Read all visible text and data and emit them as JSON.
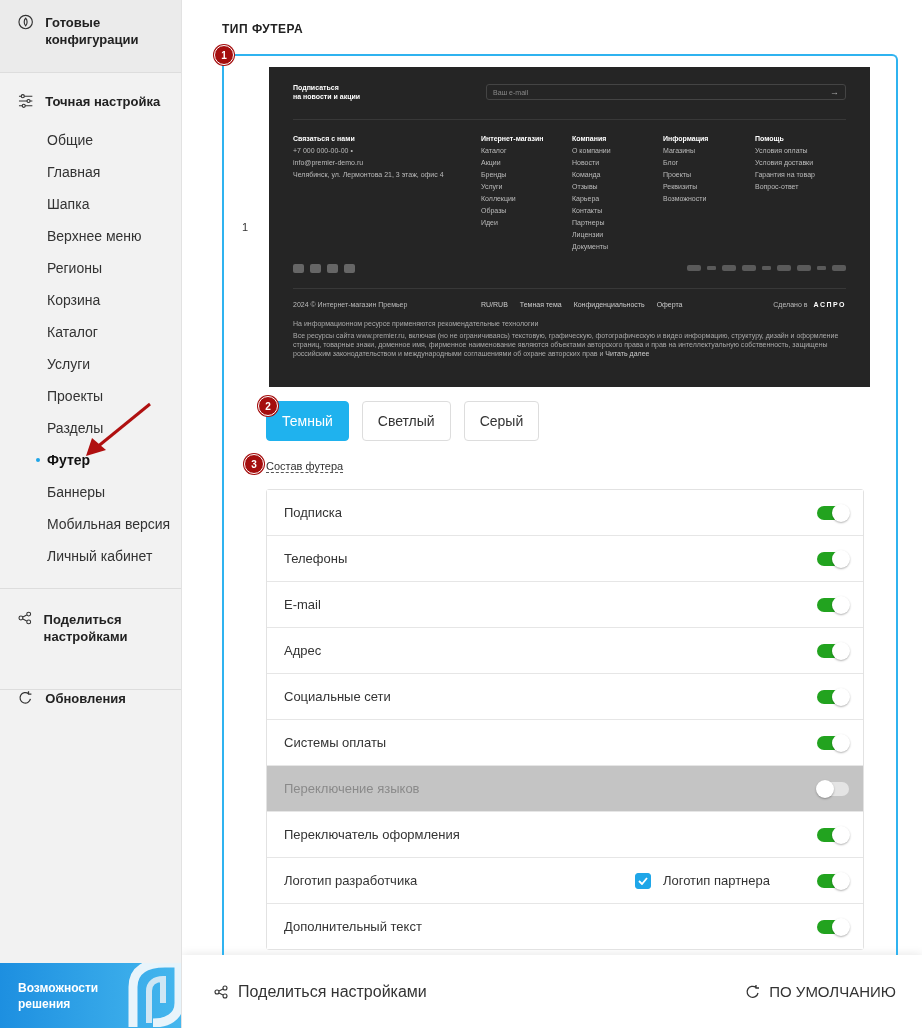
{
  "sidebar": {
    "presets": {
      "label": "Готовые конфигурации"
    },
    "tuning": {
      "label": "Точная настройка",
      "items": [
        {
          "label": "Общие",
          "selected": false
        },
        {
          "label": "Главная",
          "selected": false
        },
        {
          "label": "Шапка",
          "selected": false
        },
        {
          "label": "Верхнее меню",
          "selected": false
        },
        {
          "label": "Регионы",
          "selected": false
        },
        {
          "label": "Корзина",
          "selected": false
        },
        {
          "label": "Каталог",
          "selected": false
        },
        {
          "label": "Услуги",
          "selected": false
        },
        {
          "label": "Проекты",
          "selected": false
        },
        {
          "label": "Разделы",
          "selected": false
        },
        {
          "label": "Футер",
          "selected": true
        },
        {
          "label": "Баннеры",
          "selected": false
        },
        {
          "label": "Мобильная версия",
          "selected": false
        },
        {
          "label": "Личный кабинет",
          "selected": false
        }
      ]
    },
    "share": {
      "label": "Поделиться настройками"
    },
    "updates": {
      "label": "Обновления"
    },
    "promo": {
      "label": "Возможности решения"
    }
  },
  "main": {
    "section_title": "ТИП ФУТЕРА",
    "variant": {
      "badge": "1",
      "label": "1",
      "preview": {
        "subscribe": {
          "title": "Подписаться",
          "subtitle": "на новости и акции",
          "placeholder": "Ваш e-mail",
          "submit": "→"
        },
        "contacts": {
          "title": "Связаться с нами",
          "lines": [
            "+7 000 000-00-00 •",
            "info@premier-demo.ru",
            "Челябинск, ул. Лермонтова 21, 3 этаж, офис 4"
          ]
        },
        "columns": [
          {
            "title": "Интернет-магазин",
            "links": [
              "Каталог",
              "Акции",
              "Бренды",
              "Услуги",
              "Коллекции",
              "Образы",
              "Идеи"
            ]
          },
          {
            "title": "Компания",
            "links": [
              "О компании",
              "Новости",
              "Команда",
              "Отзывы",
              "Карьера",
              "Контакты",
              "Партнеры",
              "Лицензии",
              "Документы"
            ]
          },
          {
            "title": "Информация",
            "links": [
              "Магазины",
              "Блог",
              "Проекты",
              "Реквизиты",
              "Возможности"
            ]
          },
          {
            "title": "Помощь",
            "links": [
              "Условия оплаты",
              "Условия доставки",
              "Гарантия на товар",
              "Вопрос-ответ"
            ]
          }
        ],
        "copyright": "2024 © Интернет-магазин Премьер",
        "links": [
          "RU/RUB",
          "Темная тема",
          "Конфиденциальность",
          "Оферта"
        ],
        "made_in": "Сделано в",
        "brand": "АСПРО",
        "note": "На информационном ресурсе применяются рекомендательные технологии",
        "legal": "Все ресурсы сайта www.premier.ru, включая (но не ограничиваясь) текстовую, графическую, фотографическую и видео информацию, структуру, дизайн и оформление страниц, товарные знаки, доменное имя, фирменное наименование являются объектами авторского права и прав на интеллектуальную собственность,  защищены российским законодательством и международными соглашениями об охране авторских прав и",
        "read_more": "Читать далее"
      }
    },
    "schemes_badge": "2",
    "color_schemes": [
      {
        "label": "Темный",
        "selected": true
      },
      {
        "label": "Светлый",
        "selected": false
      },
      {
        "label": "Серый",
        "selected": false
      }
    ],
    "composition": {
      "badge": "3",
      "title": "Состав футера",
      "rows": [
        {
          "label": "Подписка",
          "on": true,
          "disabled": false
        },
        {
          "label": "Телефоны",
          "on": true,
          "disabled": false
        },
        {
          "label": "E-mail",
          "on": true,
          "disabled": false
        },
        {
          "label": "Адрес",
          "on": true,
          "disabled": false
        },
        {
          "label": "Социальные сети",
          "on": true,
          "disabled": false
        },
        {
          "label": "Системы оплаты",
          "on": true,
          "disabled": false
        },
        {
          "label": "Переключение языков",
          "on": false,
          "disabled": true
        },
        {
          "label": "Переключатель оформления",
          "on": true,
          "disabled": false
        },
        {
          "label": "Логотип разработчика",
          "on": true,
          "disabled": false,
          "extra": {
            "label": "Логотип партнера",
            "checked": true
          }
        },
        {
          "label": "Дополнительный текст",
          "on": true,
          "disabled": false
        }
      ]
    }
  },
  "bottom_bar": {
    "share": "Поделиться настройками",
    "reset": "ПО УМОЛЧАНИЮ"
  }
}
